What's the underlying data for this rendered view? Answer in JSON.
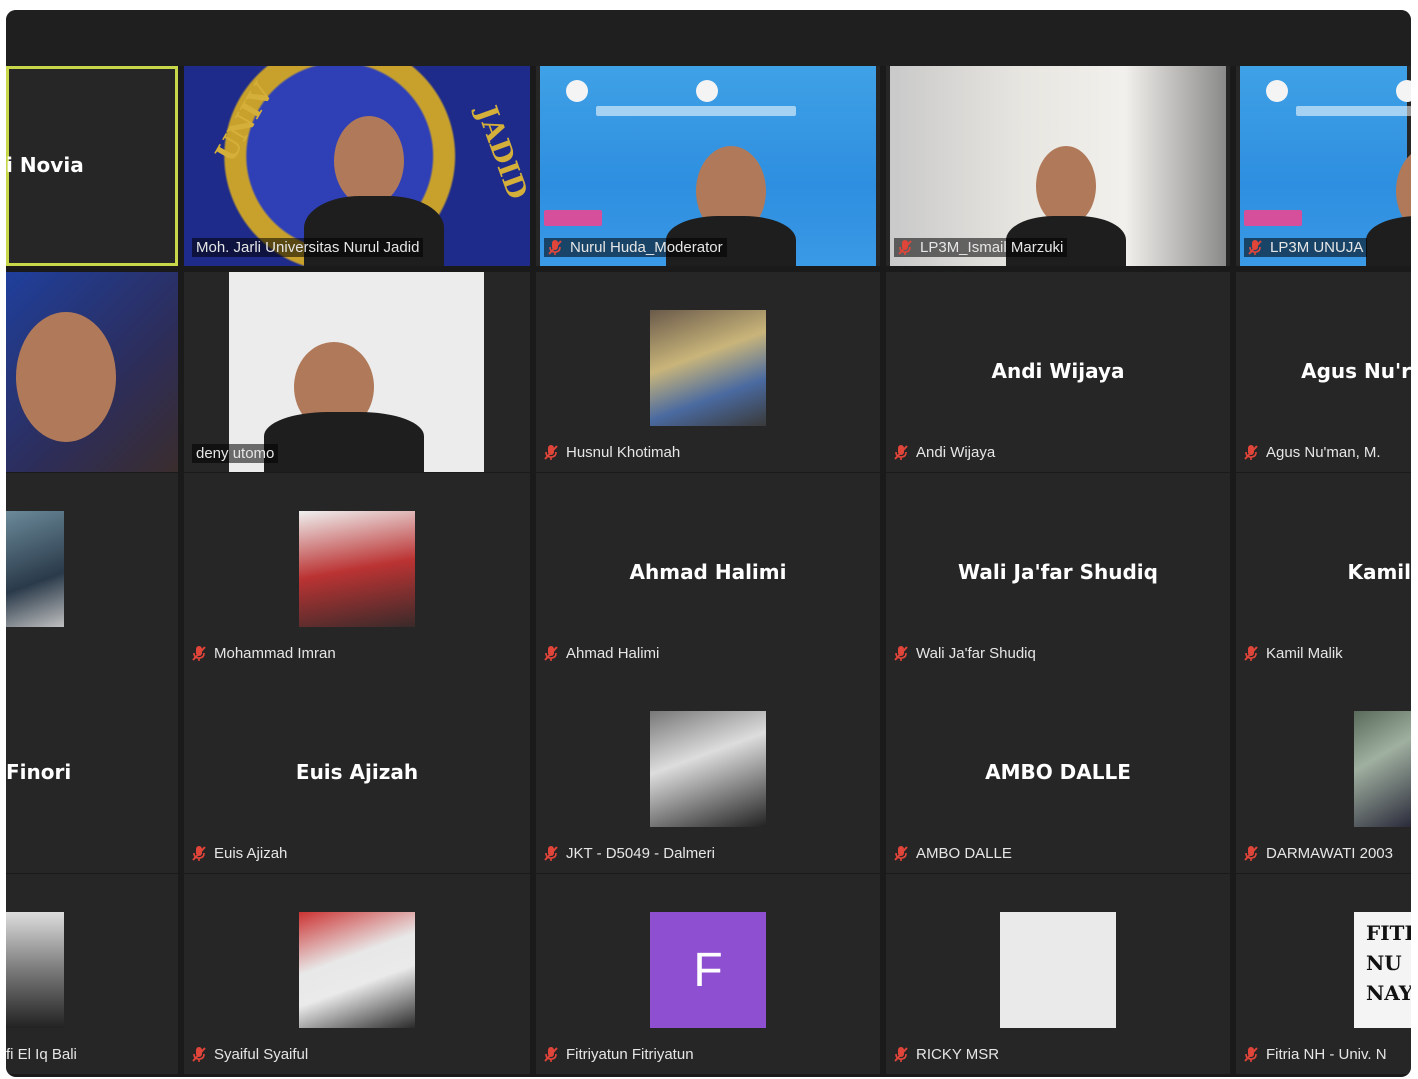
{
  "participants": [
    {
      "row": 0,
      "col": 0,
      "center_name": "i Novia",
      "label": "",
      "muted": false,
      "kind": "name",
      "active": true
    },
    {
      "row": 0,
      "col": 1,
      "center_name": "",
      "label": "Moh. Jarli Universitas Nurul Jadid",
      "muted": false,
      "kind": "video-univ"
    },
    {
      "row": 0,
      "col": 2,
      "center_name": "",
      "label": "Nurul Huda_Moderator",
      "muted": true,
      "kind": "video-blue"
    },
    {
      "row": 0,
      "col": 3,
      "center_name": "",
      "label": "LP3M_Ismail Marzuki",
      "muted": true,
      "kind": "video-wall"
    },
    {
      "row": 0,
      "col": 4,
      "center_name": "",
      "label": "LP3M UNUJA",
      "muted": true,
      "kind": "video-blue"
    },
    {
      "row": 1,
      "col": 0,
      "center_name": "",
      "label": "",
      "muted": false,
      "kind": "video-dark"
    },
    {
      "row": 1,
      "col": 1,
      "center_name": "",
      "label": "deny utomo",
      "muted": false,
      "kind": "video-white"
    },
    {
      "row": 1,
      "col": 2,
      "center_name": "",
      "label": "Husnul Khotimah",
      "muted": true,
      "kind": "photo",
      "thumb": "t1"
    },
    {
      "row": 1,
      "col": 3,
      "center_name": "Andi Wijaya",
      "label": "Andi Wijaya",
      "muted": true,
      "kind": "name"
    },
    {
      "row": 1,
      "col": 4,
      "center_name": "Agus  Nu'r",
      "label": "Agus Nu'man, M.",
      "muted": true,
      "kind": "name"
    },
    {
      "row": 2,
      "col": 0,
      "center_name": "",
      "label": "",
      "muted": false,
      "kind": "photo-edge",
      "thumb": "t3"
    },
    {
      "row": 2,
      "col": 1,
      "center_name": "",
      "label": "Mohammad Imran",
      "muted": true,
      "kind": "photo",
      "thumb": "t2"
    },
    {
      "row": 2,
      "col": 2,
      "center_name": "Ahmad Halimi",
      "label": "Ahmad Halimi",
      "muted": true,
      "kind": "name"
    },
    {
      "row": 2,
      "col": 3,
      "center_name": "Wali Ja'far Shudiq",
      "label": "Wali Ja'far Shudiq",
      "muted": true,
      "kind": "name"
    },
    {
      "row": 2,
      "col": 4,
      "center_name": "Kamil",
      "label": "Kamil Malik",
      "muted": true,
      "kind": "name"
    },
    {
      "row": 3,
      "col": 0,
      "center_name": "Finori",
      "label": "",
      "muted": false,
      "kind": "name"
    },
    {
      "row": 3,
      "col": 1,
      "center_name": "Euis Ajizah",
      "label": "Euis Ajizah",
      "muted": true,
      "kind": "name"
    },
    {
      "row": 3,
      "col": 2,
      "center_name": "",
      "label": "JKT - D5049 - Dalmeri",
      "muted": true,
      "kind": "photo",
      "thumb": "t4"
    },
    {
      "row": 3,
      "col": 3,
      "center_name": "AMBO DALLE",
      "label": "AMBO DALLE",
      "muted": true,
      "kind": "name"
    },
    {
      "row": 3,
      "col": 4,
      "center_name": "",
      "label": "DARMAWATI 2003",
      "muted": true,
      "kind": "photo-right",
      "thumb": "t9"
    },
    {
      "row": 4,
      "col": 0,
      "center_name": "",
      "label": "fi El Iq Bali",
      "muted": false,
      "kind": "photo-edge",
      "thumb": "t6"
    },
    {
      "row": 4,
      "col": 1,
      "center_name": "",
      "label": "Syaiful Syaiful",
      "muted": true,
      "kind": "photo",
      "thumb": "t7"
    },
    {
      "row": 4,
      "col": 2,
      "center_name": "",
      "label": "Fitriyatun Fitriyatun",
      "muted": true,
      "kind": "avatar",
      "avatar_letter": "F"
    },
    {
      "row": 4,
      "col": 3,
      "center_name": "",
      "label": "RICKY MSR",
      "muted": true,
      "kind": "photo",
      "thumb": "t8"
    },
    {
      "row": 4,
      "col": 4,
      "center_name": "",
      "label": "Fitria NH - Univ. N",
      "muted": true,
      "kind": "textcard",
      "card_lines": [
        "FITI",
        "NU",
        "NAY"
      ]
    }
  ],
  "univ_logo_text": "UNIV",
  "univ_logo_text2": "JADID",
  "colors": {
    "background": "#1a1a1a",
    "tile": "#262626",
    "active_border": "#c8d64a",
    "muted_mic": "#e0453a",
    "avatar": "#8e4fd0"
  }
}
